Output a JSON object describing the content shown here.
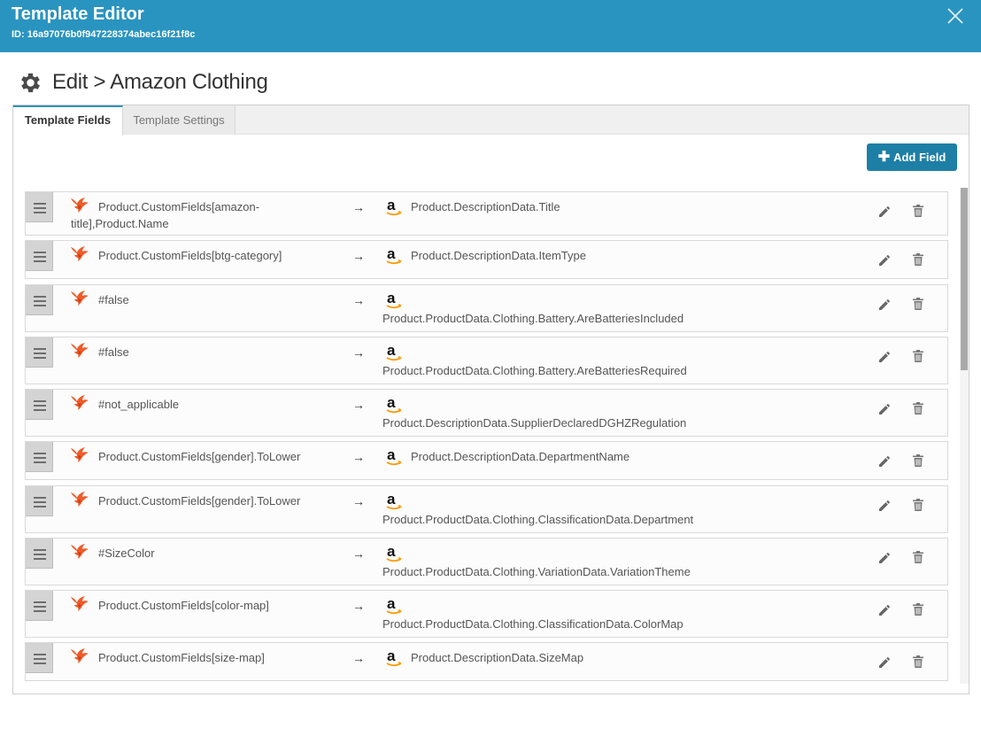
{
  "header": {
    "title": "Template Editor",
    "id_text": "ID: 16a97076b0f947228374abec16f21f8c",
    "close_icon": "close-icon"
  },
  "page": {
    "title": "Edit > Amazon Clothing",
    "title_icon": "gear-icon"
  },
  "tabs": [
    {
      "label": "Template Fields",
      "active": true
    },
    {
      "label": "Template Settings",
      "active": false
    }
  ],
  "add_field_label": "Add Field",
  "arrow_glyph": "→",
  "colors": {
    "header_bg": "#2a94c0",
    "button_bg": "#1e7fa6",
    "source_brand": "#f05a28",
    "amazon_smile": "#ff9900"
  },
  "fields": [
    {
      "source": "Product.CustomFields[amazon-title],Product.Name",
      "target": "Product.DescriptionData.Title"
    },
    {
      "source": "Product.CustomFields[btg-category]",
      "target": "Product.DescriptionData.ItemType"
    },
    {
      "source": "#false",
      "target": "Product.ProductData.Clothing.Battery.AreBatteriesIncluded"
    },
    {
      "source": "#false",
      "target": "Product.ProductData.Clothing.Battery.AreBatteriesRequired"
    },
    {
      "source": "#not_applicable",
      "target": "Product.DescriptionData.SupplierDeclaredDGHZRegulation"
    },
    {
      "source": "Product.CustomFields[gender].ToLower",
      "target": "Product.DescriptionData.DepartmentName"
    },
    {
      "source": "Product.CustomFields[gender].ToLower",
      "target": "Product.ProductData.Clothing.ClassificationData.Department"
    },
    {
      "source": "#SizeColor",
      "target": "Product.ProductData.Clothing.VariationData.VariationTheme"
    },
    {
      "source": "Product.CustomFields[color-map]",
      "target": "Product.ProductData.Clothing.ClassificationData.ColorMap"
    },
    {
      "source": "Product.CustomFields[size-map]",
      "target": "Product.DescriptionData.SizeMap"
    }
  ]
}
